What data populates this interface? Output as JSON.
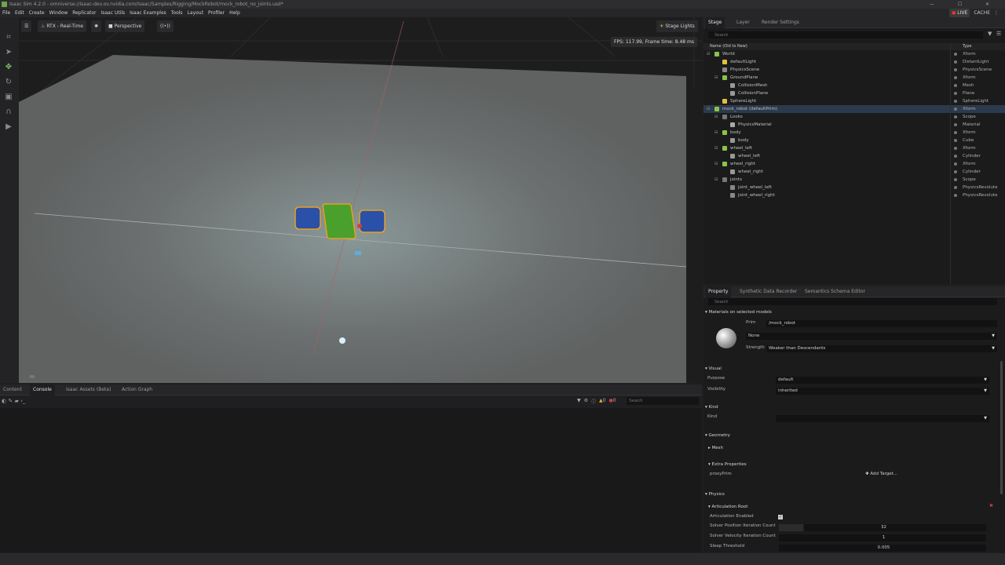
{
  "window": {
    "title": "Isaac Sim 4.2.0 - omniverse://isaac-dev.ov.nvidia.com/Isaac/Samples/Rigging/MockRobot/mock_robot_no_joints.usd*",
    "controls": "—  ☐  ✕"
  },
  "menu": [
    "File",
    "Edit",
    "Create",
    "Window",
    "Replicator",
    "Isaac Utils",
    "Isaac Examples",
    "Tools",
    "Layout",
    "Profiler",
    "Help"
  ],
  "menu_right": {
    "live": "LIVE",
    "cache": "CACHE"
  },
  "viewport": {
    "renderer": "RTX - Real-Time",
    "camera": "Perspective",
    "lights": "Stage Lights",
    "fps": "FPS: 117.99, Frame time: 8.48 ms",
    "units": "m"
  },
  "bottom_tabs": [
    "Content",
    "Console",
    "Isaac Assets (Beta)",
    "Action Graph"
  ],
  "console": {
    "search_placeholder": "Search",
    "warn_count": "0",
    "err_count": "0"
  },
  "stage": {
    "tabs": [
      "Stage",
      "Layer",
      "Render Settings"
    ],
    "search_placeholder": "Search",
    "col_name": "Name (Old to New)",
    "col_type": "Type",
    "rows": [
      {
        "name": "World",
        "type": "Xform",
        "depth": 0
      },
      {
        "name": "defaultLight",
        "type": "DistantLight",
        "depth": 1
      },
      {
        "name": "PhysicsScene",
        "type": "PhysicsScene",
        "depth": 1
      },
      {
        "name": "GroundPlane",
        "type": "Xform",
        "depth": 1
      },
      {
        "name": "CollisionMesh",
        "type": "Mesh",
        "depth": 2
      },
      {
        "name": "CollisionPlane",
        "type": "Plane",
        "depth": 2
      },
      {
        "name": "SphereLight",
        "type": "SphereLight",
        "depth": 1
      },
      {
        "name": "mock_robot (defaultPrim)",
        "type": "Xform",
        "depth": 0
      },
      {
        "name": "Looks",
        "type": "Scope",
        "depth": 1
      },
      {
        "name": "PhysicsMaterial",
        "type": "Material",
        "depth": 2
      },
      {
        "name": "body",
        "type": "Xform",
        "depth": 1
      },
      {
        "name": "body",
        "type": "Cube",
        "depth": 2
      },
      {
        "name": "wheel_left",
        "type": "Xform",
        "depth": 1
      },
      {
        "name": "wheel_left",
        "type": "Cylinder",
        "depth": 2
      },
      {
        "name": "wheel_right",
        "type": "Xform",
        "depth": 1
      },
      {
        "name": "wheel_right",
        "type": "Cylinder",
        "depth": 2
      },
      {
        "name": "joints",
        "type": "Scope",
        "depth": 1
      },
      {
        "name": "joint_wheel_left",
        "type": "PhysicsRevolute",
        "depth": 2
      },
      {
        "name": "joint_wheel_right",
        "type": "PhysicsRevolute",
        "depth": 2
      }
    ]
  },
  "property": {
    "tabs": [
      "Property",
      "Synthetic Data Recorder",
      "Semantics Schema Editor"
    ],
    "search_placeholder": "Search",
    "materials_section": "Materials on selected models",
    "prim_label": "Prim",
    "prim_value": "/mock_robot",
    "material_value": "None",
    "strength_label": "Strength",
    "strength_value": "Weaker than Descendants",
    "visual_section": "Visual",
    "purpose_label": "Purpose",
    "purpose_value": "default",
    "visibility_label": "Visibility",
    "visibility_value": "inherited",
    "kind_section": "Kind",
    "kind_label": "Kind",
    "kind_value": "",
    "geometry_section": "Geometry",
    "mesh_section": "Mesh",
    "extra_section": "Extra Properties",
    "proxy_label": "proxyPrim",
    "add_target": "Add Target...",
    "physics_section": "Physics",
    "articulation_section": "Articulation Root",
    "art_enabled_label": "Articulation Enabled",
    "solver_pos_label": "Solver Position Iteration Count",
    "solver_pos_value": "32",
    "solver_vel_label": "Solver Velocity Iteration Count",
    "solver_vel_value": "1",
    "sleep_label": "Sleep Threshold",
    "sleep_value": "0.005"
  },
  "colors": {
    "robot_body": "#4aa02c",
    "wheels": "#2a50a8",
    "selection": "#e8a020",
    "accent": "#5aa832"
  }
}
